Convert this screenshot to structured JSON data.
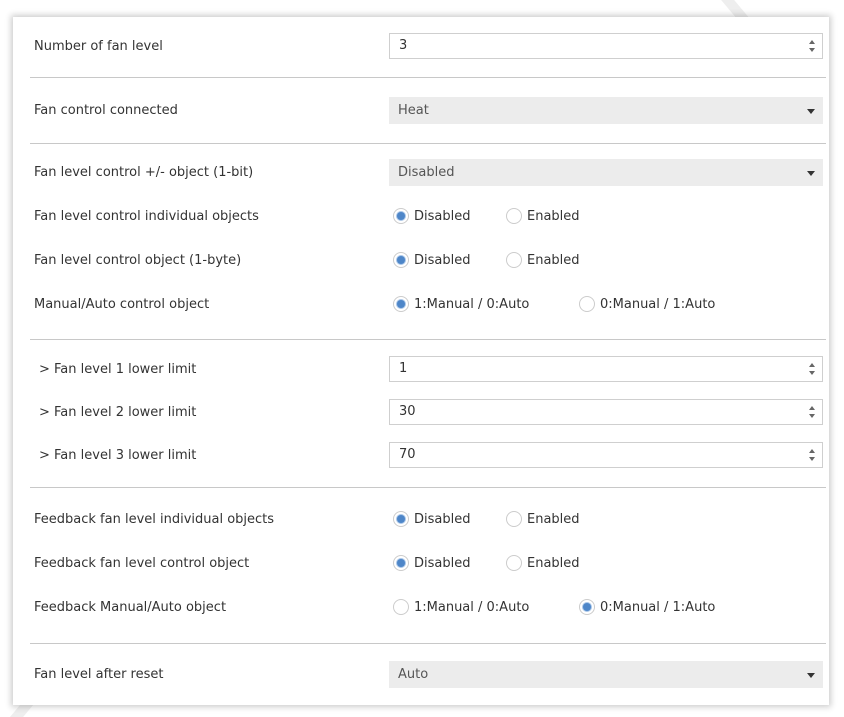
{
  "fields": {
    "num_fan_level": {
      "label": "Number of fan level",
      "value": "3"
    },
    "fan_control_connected": {
      "label": "Fan control connected",
      "value": "Heat"
    },
    "fan_level_pm_object": {
      "label": "Fan level control +/- object (1-bit)",
      "value": "Disabled"
    },
    "fan_level_individual": {
      "label": "Fan level control individual objects",
      "options": [
        "Disabled",
        "Enabled"
      ],
      "selected": "Disabled"
    },
    "fan_level_object_byte": {
      "label": "Fan level control object (1-byte)",
      "options": [
        "Disabled",
        "Enabled"
      ],
      "selected": "Disabled"
    },
    "manual_auto_object": {
      "label": "Manual/Auto control object",
      "options": [
        "1:Manual / 0:Auto",
        "0:Manual / 1:Auto"
      ],
      "selected": "1:Manual / 0:Auto"
    },
    "level1_lower": {
      "label": "> Fan level 1 lower limit",
      "value": "1"
    },
    "level2_lower": {
      "label": "> Fan level 2 lower limit",
      "value": "30"
    },
    "level3_lower": {
      "label": "> Fan level 3 lower limit",
      "value": "70"
    },
    "feedback_individual": {
      "label": "Feedback fan level individual objects",
      "options": [
        "Disabled",
        "Enabled"
      ],
      "selected": "Disabled"
    },
    "feedback_control_object": {
      "label": "Feedback fan level control object",
      "options": [
        "Disabled",
        "Enabled"
      ],
      "selected": "Disabled"
    },
    "feedback_manual_auto": {
      "label": "Feedback Manual/Auto object",
      "options": [
        "1:Manual / 0:Auto",
        "0:Manual / 1:Auto"
      ],
      "selected": "0:Manual / 1:Auto"
    },
    "fan_level_after_reset": {
      "label": "Fan level after reset",
      "value": "Auto"
    }
  },
  "icons": {
    "spinner": "up-down-arrows-icon",
    "dropdown": "caret-down-icon",
    "radio": "radio-button-icon"
  },
  "colors": {
    "radio_accent": "#4e86c8",
    "select_bg": "#ececec",
    "separator": "#c8c8c8"
  }
}
